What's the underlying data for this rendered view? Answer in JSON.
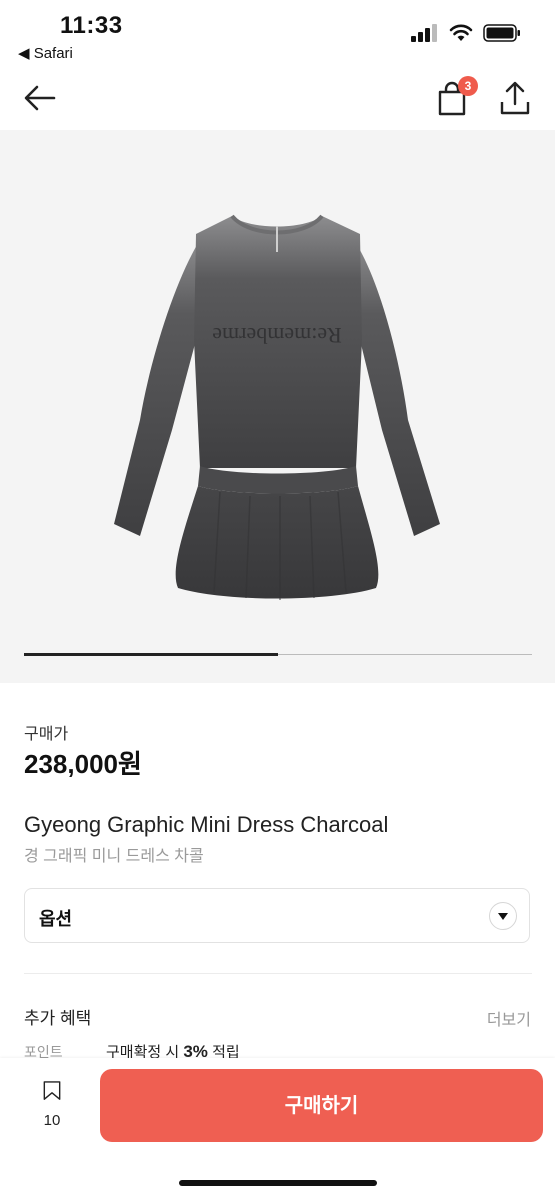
{
  "status_bar": {
    "time": "11:33",
    "back_app": "◀ Safari"
  },
  "nav": {
    "cart_count": "3",
    "icons": [
      "back-arrow-icon",
      "shopping-bag-icon",
      "share-icon"
    ]
  },
  "product": {
    "image_slider_progress": 0.5,
    "image_print_text": "Re:memberme",
    "price_label": "구매가",
    "price": "238,000원",
    "title_en": "Gyeong Graphic Mini Dress Charcoal",
    "title_ko": "경 그래픽 미니 드레스 차콜"
  },
  "option": {
    "label": "옵션"
  },
  "benefits": {
    "title": "추가 혜택",
    "more": "더보기",
    "point_label": "포인트",
    "point_text": "구매확정 시 3% 적립"
  },
  "bottom": {
    "bookmark_count": "10",
    "buy_label": "구매하기"
  },
  "colors": {
    "accent": "#ef5f52",
    "badge": "#ef5b4c",
    "dress": "#4a4a4c"
  }
}
